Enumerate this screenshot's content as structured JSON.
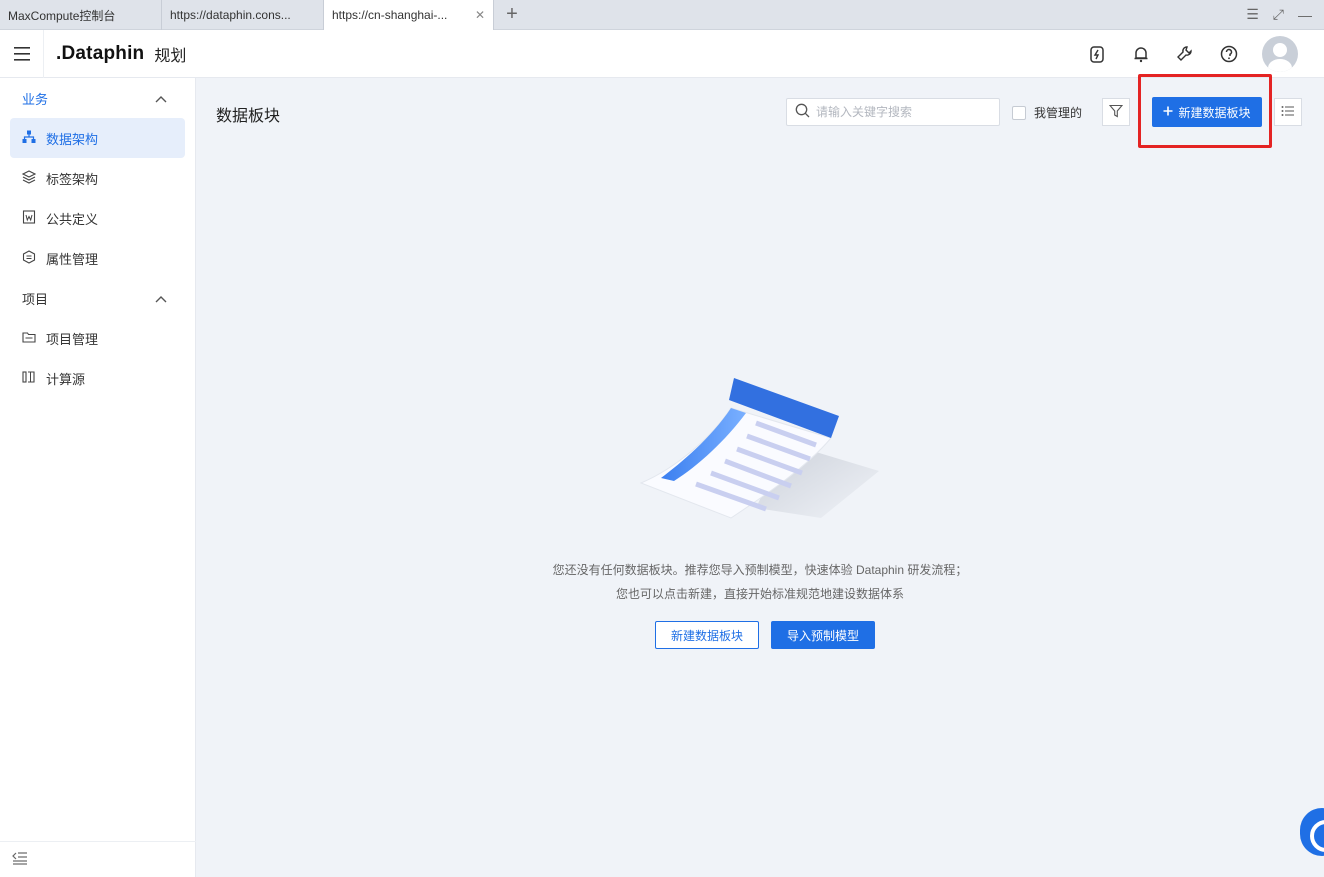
{
  "browser": {
    "tabs": [
      {
        "label": "MaxCompute控制台"
      },
      {
        "label": "https://dataphin.cons..."
      },
      {
        "label": "https://cn-shanghai-..."
      }
    ],
    "new_tab": "+"
  },
  "header": {
    "logo": "Dataphin",
    "module": "规划"
  },
  "sidebar": {
    "sections": [
      {
        "label": "业务",
        "items": [
          "数据架构",
          "标签架构",
          "公共定义",
          "属性管理"
        ]
      },
      {
        "label": "项目",
        "items": [
          "项目管理",
          "计算源"
        ]
      }
    ],
    "active_item": "数据架构"
  },
  "main": {
    "title": "数据板块",
    "search_placeholder": "请输入关键字搜索",
    "mine_label": "我管理的",
    "new_button": "新建数据板块",
    "empty_line1": "您还没有任何数据板块。推荐您导入预制模型，快速体验 Dataphin 研发流程；",
    "empty_line2": "您也可以点击新建，直接开始标准规范地建设数据体系",
    "btn_new": "新建数据板块",
    "btn_import": "导入预制模型"
  },
  "colors": {
    "primary": "#1f6fe5",
    "highlight": "#e42323",
    "active_bg": "#e6eefb"
  }
}
